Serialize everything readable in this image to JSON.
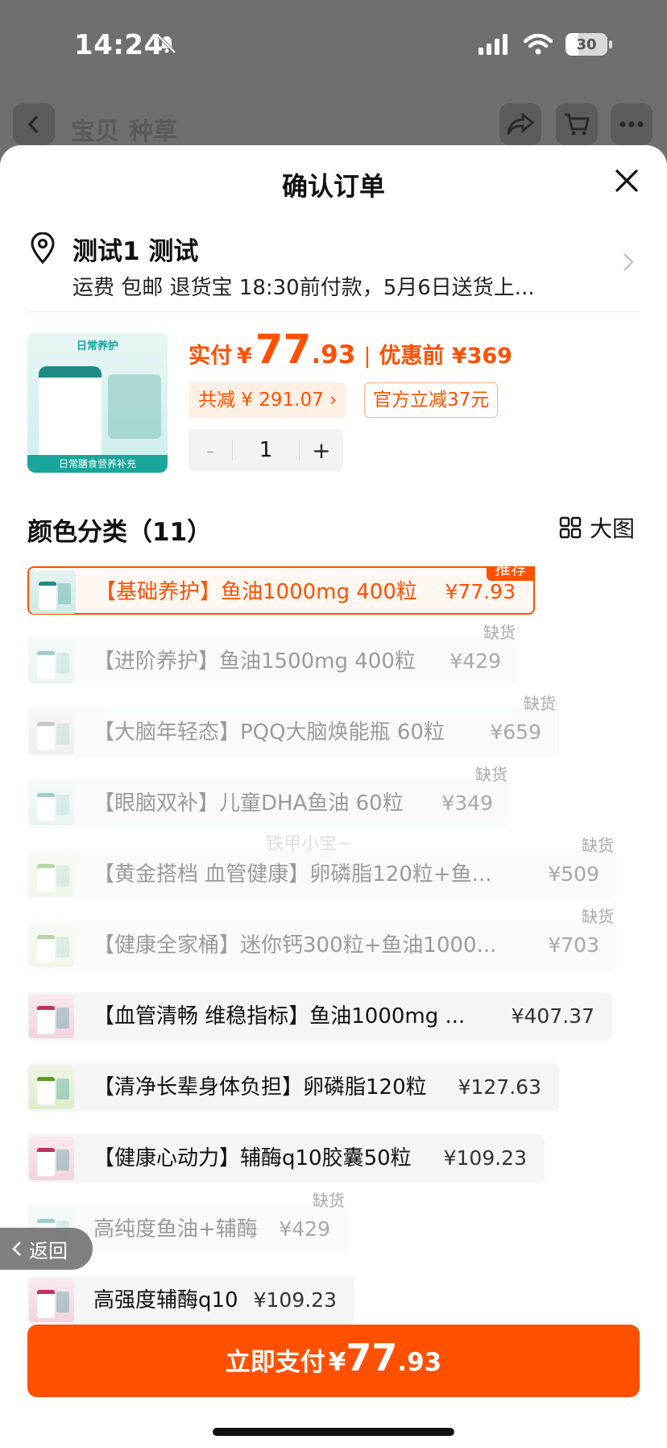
{
  "status_bar": {
    "time": "14:24",
    "battery": "30"
  },
  "background_nav": {
    "tab_1": "宝贝",
    "tab_2": "种草"
  },
  "sheet": {
    "title": "确认订单"
  },
  "address": {
    "name": "测试1 测试",
    "details": "运费 包邮 退货宝 18:30前付款，5月6日送货上..."
  },
  "product": {
    "thumb_title": "日常养护",
    "thumb_footer": "日常膳食营养补充",
    "price_label": "实付",
    "currency": "¥",
    "price_int": "77",
    "price_dec": ".93",
    "separator": "|",
    "original_label": "优惠前 ¥369",
    "discount": "共减 ¥ 291.07 ›",
    "official_discount": "官方立减37元",
    "quantity": "1",
    "minus": "-",
    "plus": "+"
  },
  "variants_section": {
    "title": "颜色分类（11）",
    "big_view_label": "大图"
  },
  "variants": [
    {
      "name": "【基础养护】鱼油1000mg 400粒",
      "price": "¥77.93",
      "badge": "推荐"
    },
    {
      "name": "【进阶养护】鱼油1500mg 400粒",
      "price": "¥429",
      "badge": "缺货"
    },
    {
      "name": "【大脑年轻态】PQQ大脑焕能瓶 60粒",
      "price": "¥659",
      "badge": "缺货"
    },
    {
      "name": "【眼脑双补】儿童DHA鱼油 60粒",
      "price": "¥349",
      "badge": "缺货"
    },
    {
      "name": "【黄金搭档 血管健康】卵磷脂120粒+鱼...",
      "price": "¥509",
      "badge": "缺货"
    },
    {
      "name": "【健康全家桶】迷你钙300粒+鱼油1000...",
      "price": "¥703",
      "badge": "缺货"
    },
    {
      "name": "【血管清畅 维稳指标】鱼油1000mg ...",
      "price": "¥407.37",
      "badge": ""
    },
    {
      "name": "【清净长辈身体负担】卵磷脂120粒",
      "price": "¥127.63",
      "badge": ""
    },
    {
      "name": "【健康心动力】辅酶q10胶囊50粒",
      "price": "¥109.23",
      "badge": ""
    },
    {
      "name": "高纯度鱼油+辅酶",
      "price": "¥429",
      "badge": "缺货"
    },
    {
      "name": "高强度辅酶q10",
      "price": "¥109.23",
      "badge": ""
    }
  ],
  "watermark": "铁甲小宝~",
  "back_button": {
    "label": "返回"
  },
  "pay_button": {
    "label": "立即支付",
    "currency": "¥",
    "price_int": "77",
    "price_dec": ".93"
  }
}
